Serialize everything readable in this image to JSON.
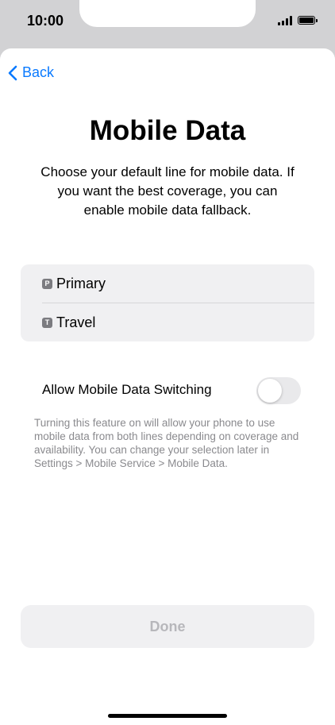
{
  "status_bar": {
    "time": "10:00",
    "icons": [
      "cellular-signal-icon",
      "battery-icon"
    ]
  },
  "nav": {
    "back_label": "Back",
    "back_icon": "chevron-left-icon",
    "accent_color": "#0a7aff"
  },
  "header": {
    "title": "Mobile Data",
    "description": "Choose your default line for mobile data. If you want the best coverage, you can enable mobile data fallback."
  },
  "lines": [
    {
      "badge": "P",
      "label": "Primary"
    },
    {
      "badge": "T",
      "label": "Travel"
    }
  ],
  "data_switching": {
    "label": "Allow Mobile Data Switching",
    "enabled": false,
    "footnote": "Turning this feature on will allow your phone to use mobile data from both lines depending on coverage and availability. You can change your selection later in Settings > Mobile Service > Mobile Data."
  },
  "actions": {
    "done_label": "Done",
    "done_enabled": false
  }
}
